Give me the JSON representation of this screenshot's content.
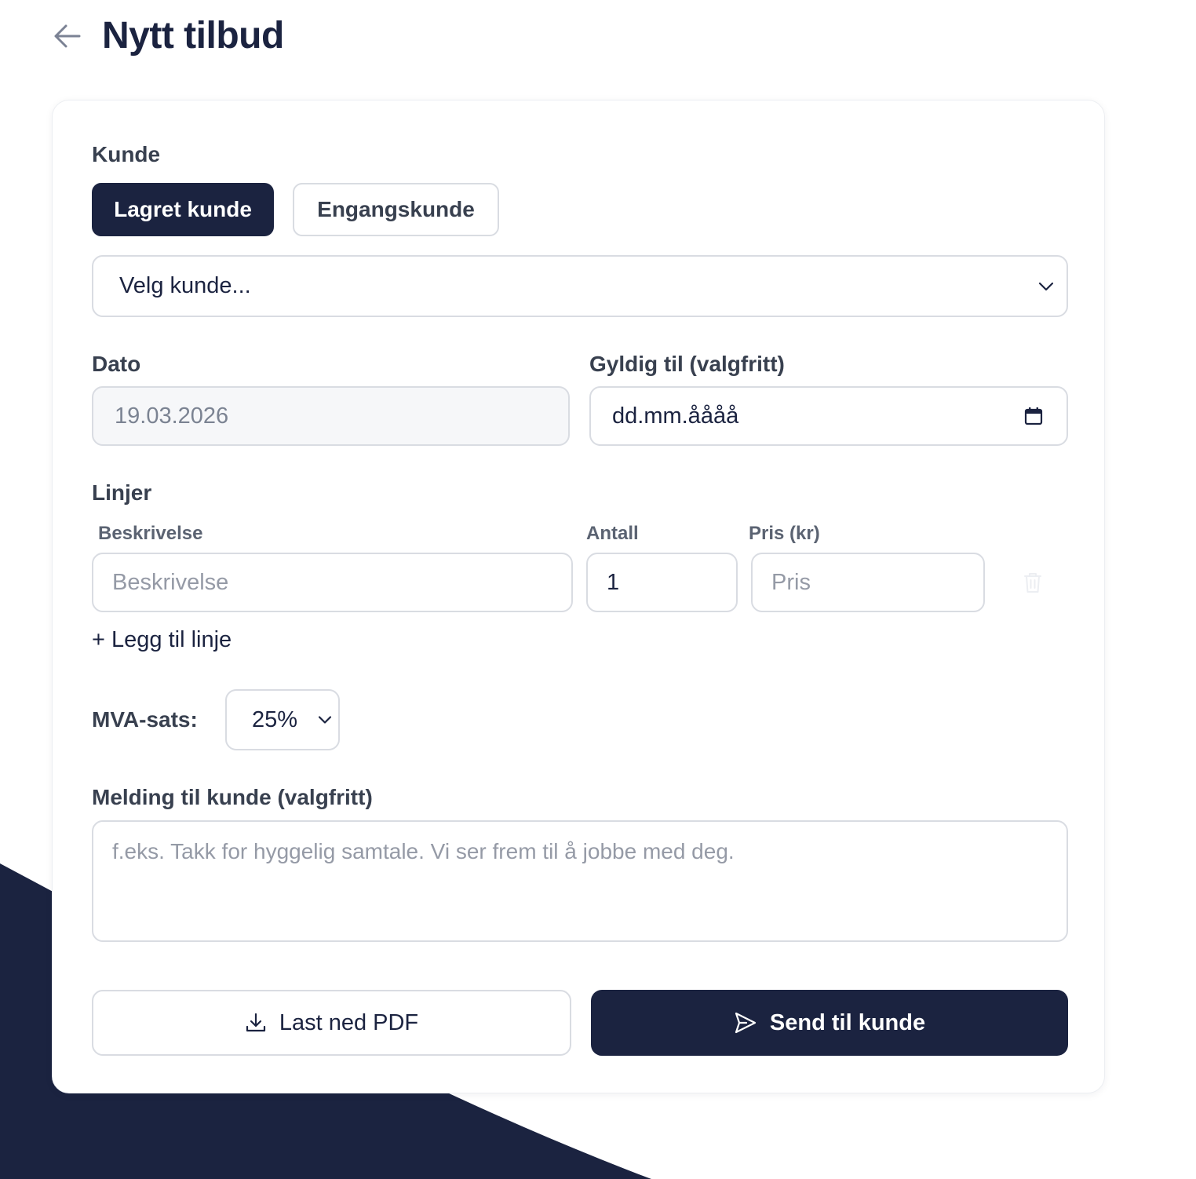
{
  "header": {
    "title": "Nytt tilbud"
  },
  "customer": {
    "label": "Kunde",
    "tabs": [
      {
        "label": "Lagret kunde",
        "active": true
      },
      {
        "label": "Engangskunde",
        "active": false
      }
    ],
    "select_value": "Velg kunde..."
  },
  "dates": {
    "date_label": "Dato",
    "date_value": "19.03.2026",
    "valid_label": "Gyldig til (valgfritt)",
    "valid_value": "dd.mm.åååå"
  },
  "lines": {
    "label": "Linjer",
    "col_description": "Beskrivelse",
    "col_quantity": "Antall",
    "col_price": "Pris (kr)",
    "rows": [
      {
        "description_placeholder": "Beskrivelse",
        "quantity": "1",
        "price_placeholder": "Pris"
      }
    ],
    "add_label": "+ Legg til linje"
  },
  "vat": {
    "label": "MVA-sats:",
    "value": "25%"
  },
  "message": {
    "label": "Melding til kunde (valgfritt)",
    "placeholder": "f.eks. Takk for hyggelig samtale. Vi ser frem til å jobbe med deg."
  },
  "actions": {
    "download_label": "Last ned PDF",
    "send_label": "Send til kunde"
  },
  "colors": {
    "primary": "#1b2340",
    "border": "#d9dce2",
    "label": "#38404f",
    "placeholder": "#959aa6"
  }
}
